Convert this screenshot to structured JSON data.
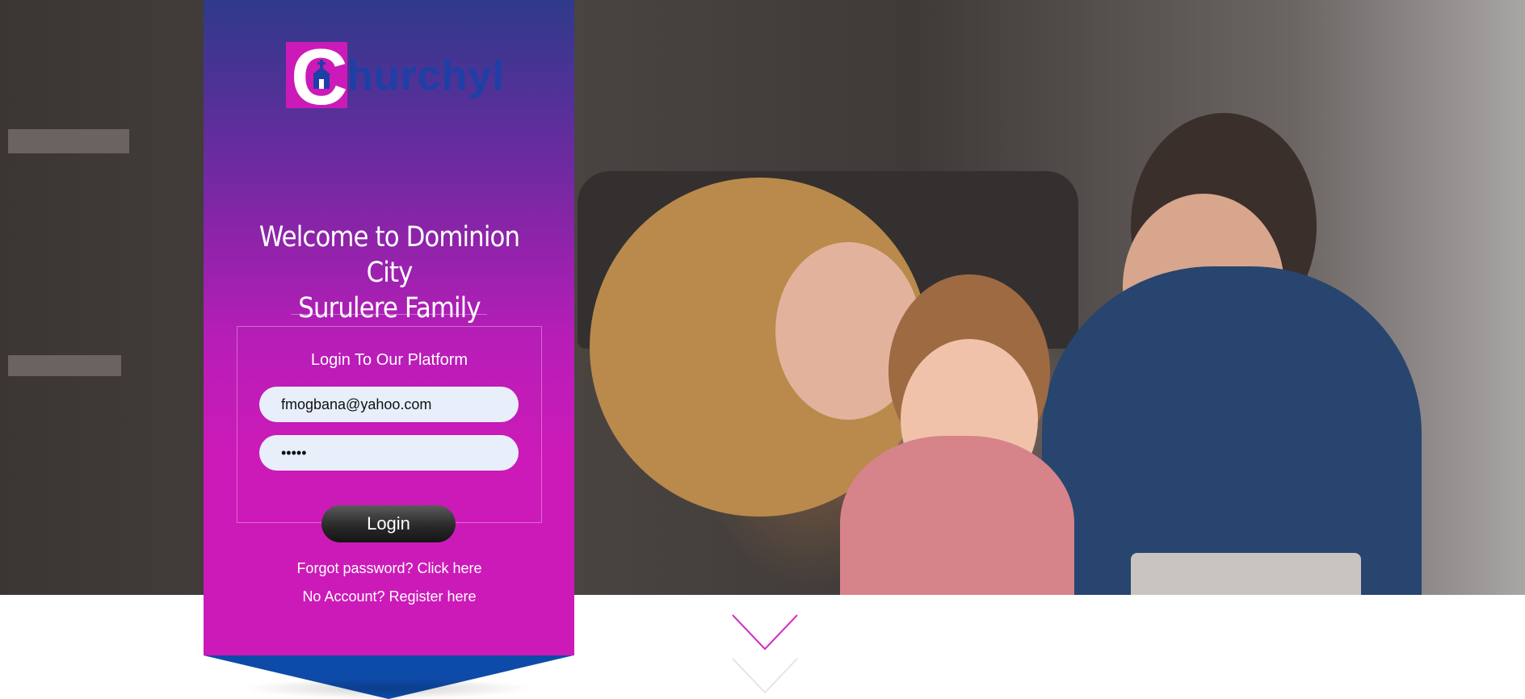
{
  "logo": {
    "initial": "C",
    "wordmark": "hurchyl"
  },
  "welcome": {
    "line1": "Welcome to Dominion City",
    "line2": "Surulere Family"
  },
  "login": {
    "heading": "Login To Our Platform",
    "email_value": "fmogbana@yahoo.com",
    "password_value": "•••••",
    "button_label": "Login",
    "forgot_text": "Forgot password? Click here",
    "register_text": "No Account? Register here"
  },
  "colors": {
    "panel_top": "#2f3a8a",
    "panel_bottom": "#cc1ab8",
    "panel_point": "#0e4aa8",
    "logo_text": "#1e3fa6",
    "field_bg": "#e8effb",
    "chevron_top": "#d42bc4",
    "chevron_bottom": "#e6e6e6"
  },
  "icons": {
    "scroll_down": "chevron-down-icon",
    "logo_mark": "church-icon"
  }
}
